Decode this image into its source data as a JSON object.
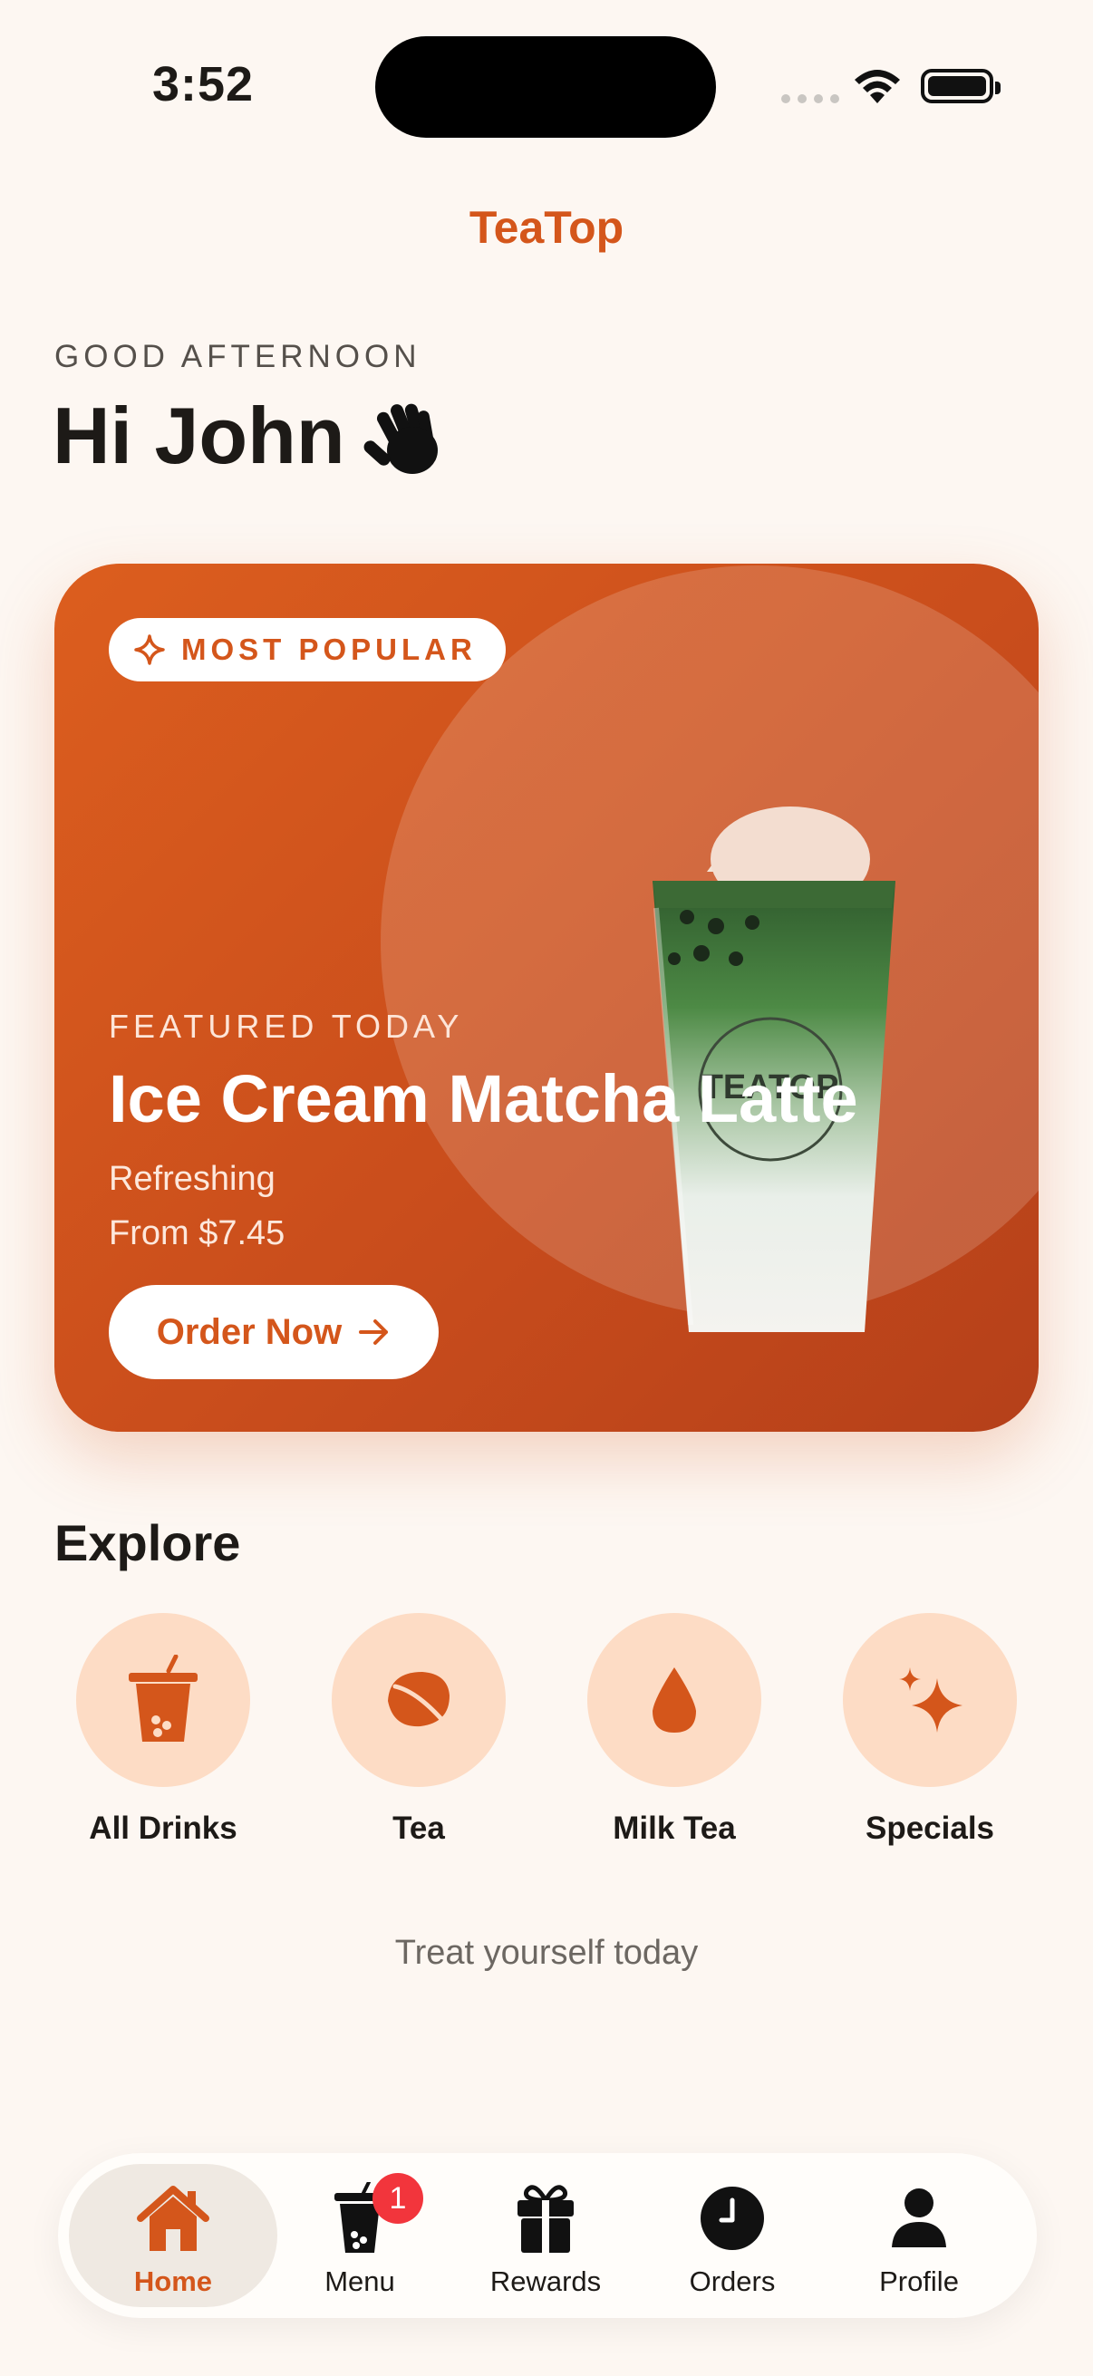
{
  "status_bar": {
    "time": "3:52"
  },
  "app": {
    "title": "TeaTop"
  },
  "greeting": {
    "subtitle": "GOOD AFTERNOON",
    "headline": "Hi John",
    "emoji_icon": "waving-hand-icon"
  },
  "hero": {
    "badge": "MOST POPULAR",
    "eyebrow": "FEATURED TODAY",
    "name": "Ice Cream Matcha Latte",
    "description": "Refreshing",
    "price": "From $7.45",
    "cta": "Order Now",
    "cup_brand": "TEATOP"
  },
  "explore": {
    "title": "Explore",
    "categories": [
      {
        "label": "All Drinks",
        "icon": "cup-icon"
      },
      {
        "label": "Tea",
        "icon": "leaf-icon"
      },
      {
        "label": "Milk Tea",
        "icon": "drop-icon"
      },
      {
        "label": "Specials",
        "icon": "sparkles-icon"
      }
    ]
  },
  "tagline": "Treat yourself today",
  "nav": {
    "items": [
      {
        "label": "Home",
        "icon": "home-icon",
        "active": true
      },
      {
        "label": "Menu",
        "icon": "boba-cup-icon",
        "badge": "1"
      },
      {
        "label": "Rewards",
        "icon": "gift-icon"
      },
      {
        "label": "Orders",
        "icon": "clock-icon"
      },
      {
        "label": "Profile",
        "icon": "person-icon"
      }
    ]
  },
  "colors": {
    "accent": "#d4561b",
    "background": "#fdf7f2",
    "category_bg": "#fddcc5",
    "badge": "#f2353c"
  }
}
